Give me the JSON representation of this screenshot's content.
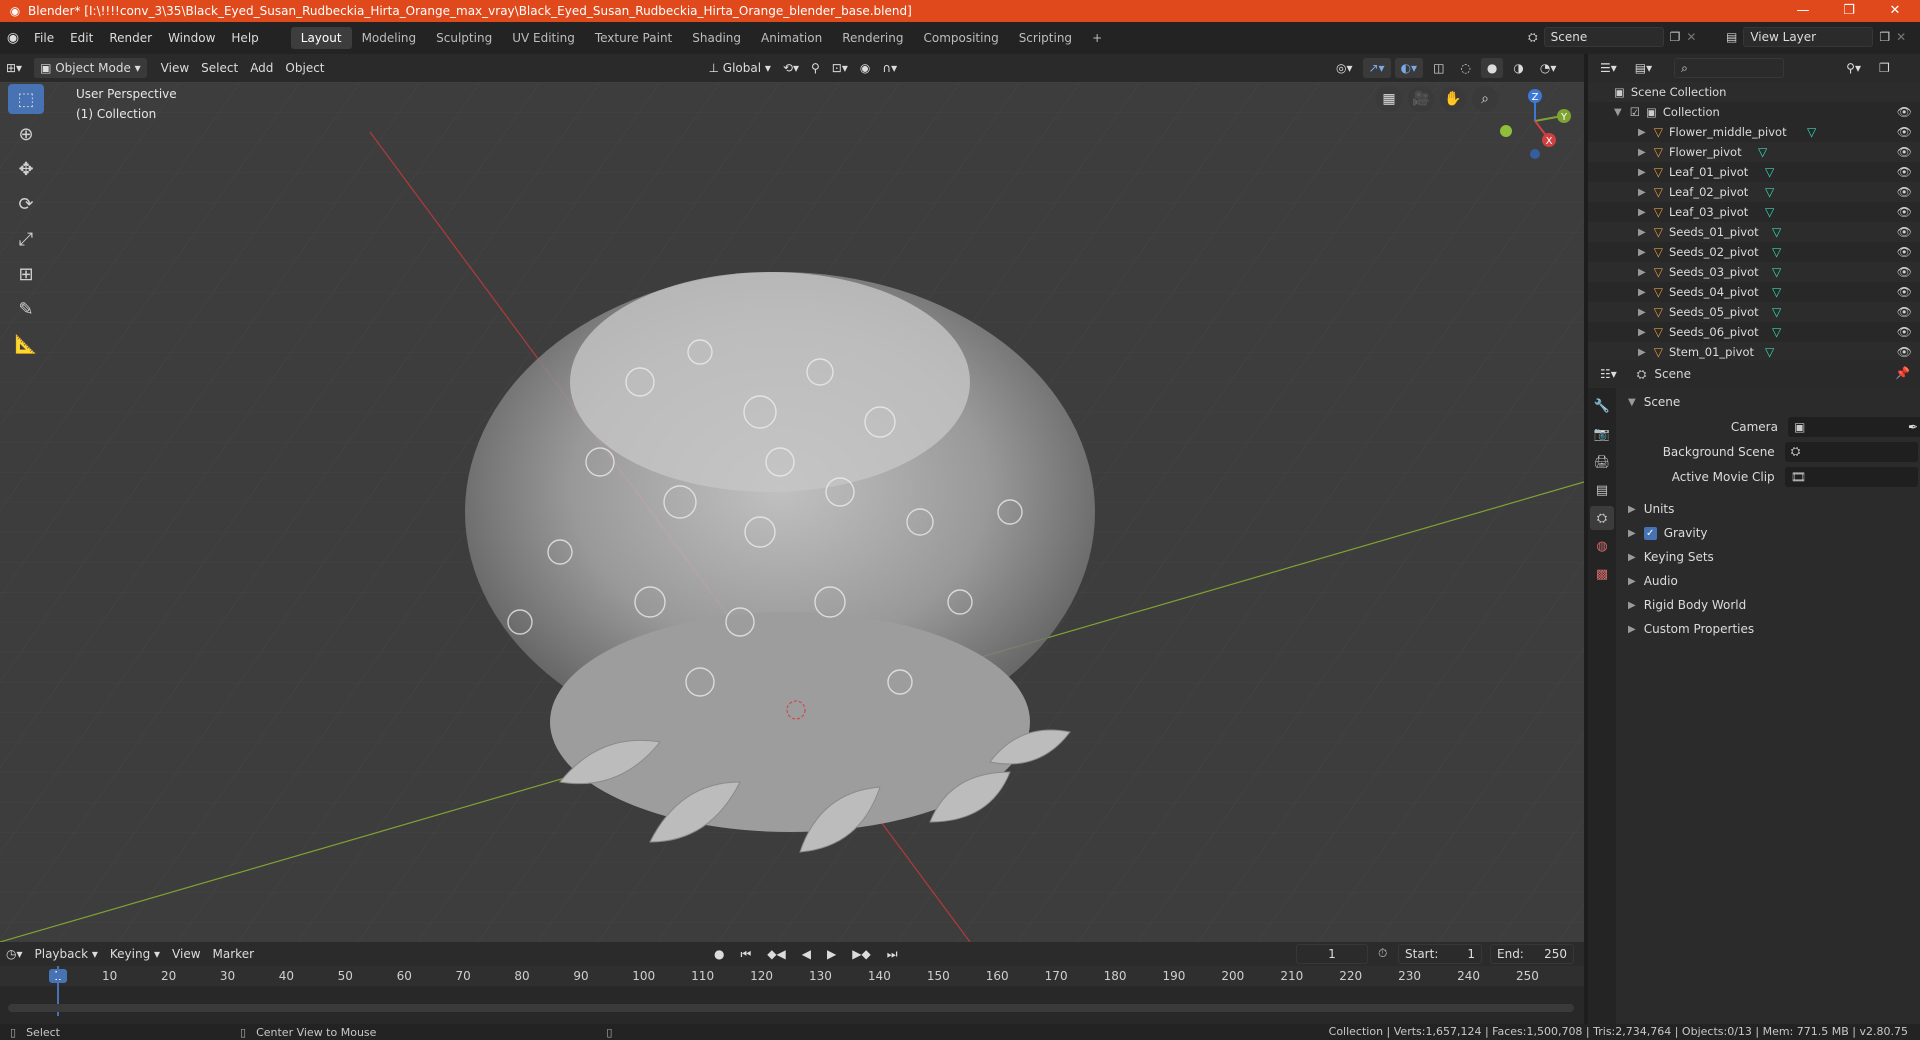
{
  "title": "Blender* [I:\\!!!!conv_3\\35\\Black_Eyed_Susan_Rudbeckia_Hirta_Orange_max_vray\\Black_Eyed_Susan_Rudbeckia_Hirta_Orange_blender_base.blend]",
  "menu": [
    "File",
    "Edit",
    "Render",
    "Window",
    "Help"
  ],
  "workspaces": [
    "Layout",
    "Modeling",
    "Sculpting",
    "UV Editing",
    "Texture Paint",
    "Shading",
    "Animation",
    "Rendering",
    "Compositing",
    "Scripting"
  ],
  "active_workspace": "Layout",
  "scene_name": "Scene",
  "view_layer": "View Layer",
  "viewport_header": {
    "mode": "Object Mode",
    "menus": [
      "View",
      "Select",
      "Add",
      "Object"
    ],
    "orientation": "Global"
  },
  "viewport_info": {
    "perspective": "User Perspective",
    "collection": "(1) Collection"
  },
  "gizmo": {
    "x": "X",
    "y": "Y",
    "z": "Z"
  },
  "outliner": {
    "root": "Scene Collection",
    "collection": "Collection",
    "items": [
      "Flower_middle_pivot",
      "Flower_pivot",
      "Leaf_01_pivot",
      "Leaf_02_pivot",
      "Leaf_03_pivot",
      "Seeds_01_pivot",
      "Seeds_02_pivot",
      "Seeds_03_pivot",
      "Seeds_04_pivot",
      "Seeds_05_pivot",
      "Seeds_06_pivot",
      "Stem_01_pivot"
    ]
  },
  "properties": {
    "header": "Scene",
    "section": "Scene",
    "fields": [
      {
        "label": "Camera"
      },
      {
        "label": "Background Scene"
      },
      {
        "label": "Active Movie Clip"
      }
    ],
    "panels": [
      "Units",
      "Gravity",
      "Keying Sets",
      "Audio",
      "Rigid Body World",
      "Custom Properties"
    ]
  },
  "timeline": {
    "menus": [
      "Playback",
      "Keying",
      "View",
      "Marker"
    ],
    "current_frame": "1",
    "start_label": "Start:",
    "start": "1",
    "end_label": "End:",
    "end": "250",
    "ticks": [
      "1",
      "10",
      "20",
      "30",
      "40",
      "50",
      "60",
      "70",
      "80",
      "90",
      "100",
      "110",
      "120",
      "130",
      "140",
      "150",
      "160",
      "170",
      "180",
      "190",
      "200",
      "210",
      "220",
      "230",
      "240",
      "250"
    ]
  },
  "status": {
    "left": "Select",
    "middle": "Center View to Mouse",
    "right": "Collection | Verts:1,657,124 | Faces:1,500,708 | Tris:2,734,764 | Objects:0/13 | Mem: 771.5 MB | v2.80.75"
  },
  "colors": {
    "titlebar": "#e0491c",
    "accent": "#4772b3",
    "x_axis": "#b33a3a",
    "y_axis": "#7fa332"
  }
}
